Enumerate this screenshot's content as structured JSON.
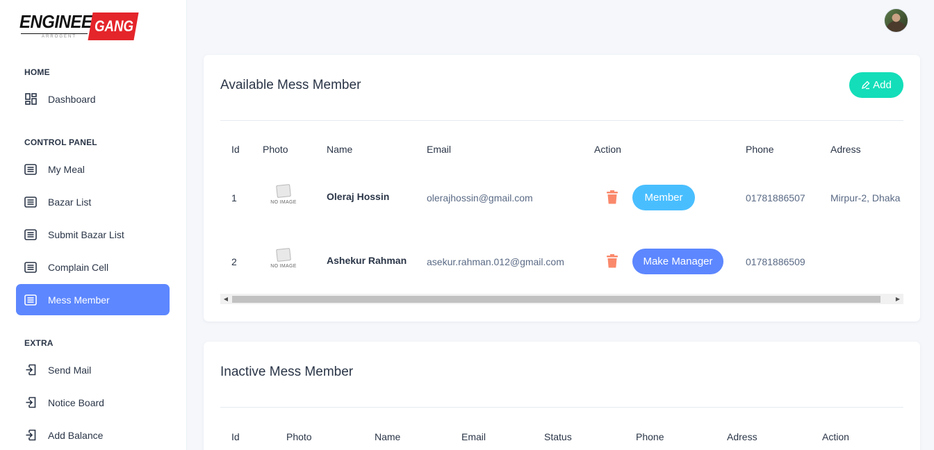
{
  "brand": {
    "word1": "ENGINEER",
    "word2": "GANG",
    "tagline": "ARROGENT"
  },
  "sidebar": {
    "sections": [
      {
        "title": "HOME",
        "items": [
          {
            "label": "Dashboard",
            "icon": "dashboard-icon"
          }
        ]
      },
      {
        "title": "CONTROL PANEL",
        "items": [
          {
            "label": "My Meal",
            "icon": "list-icon"
          },
          {
            "label": "Bazar List",
            "icon": "list-icon"
          },
          {
            "label": "Submit Bazar List",
            "icon": "list-icon"
          },
          {
            "label": "Complain Cell",
            "icon": "list-icon"
          },
          {
            "label": "Mess Member",
            "icon": "list-icon",
            "active": true
          }
        ]
      },
      {
        "title": "EXTRA",
        "items": [
          {
            "label": "Send Mail",
            "icon": "login-icon"
          },
          {
            "label": "Notice Board",
            "icon": "login-icon"
          },
          {
            "label": "Add Balance",
            "icon": "login-icon"
          }
        ]
      }
    ]
  },
  "available": {
    "title": "Available Mess Member",
    "add_label": "Add",
    "columns": [
      "Id",
      "Photo",
      "Name",
      "Email",
      "Action",
      "Phone",
      "Adress"
    ],
    "no_image_label": "NO IMAGE",
    "rows": [
      {
        "id": "1",
        "name": "Oleraj Hossin",
        "email": "olerajhossin@gmail.com",
        "action": "Member",
        "phone": "01781886507",
        "address": "Mirpur-2, Dhaka"
      },
      {
        "id": "2",
        "name": "Ashekur Rahman",
        "email": "asekur.rahman.012@gmail.com",
        "action": "Make Manager",
        "phone": "01781886509",
        "address": ""
      }
    ]
  },
  "inactive": {
    "title": "Inactive Mess Member",
    "columns": [
      "Id",
      "Photo",
      "Name",
      "Email",
      "Status",
      "Phone",
      "Adress",
      "Action"
    ]
  },
  "colors": {
    "primary": "#5d87ff",
    "success": "#13deb9",
    "info": "#49beff",
    "danger": "#fa896b"
  }
}
